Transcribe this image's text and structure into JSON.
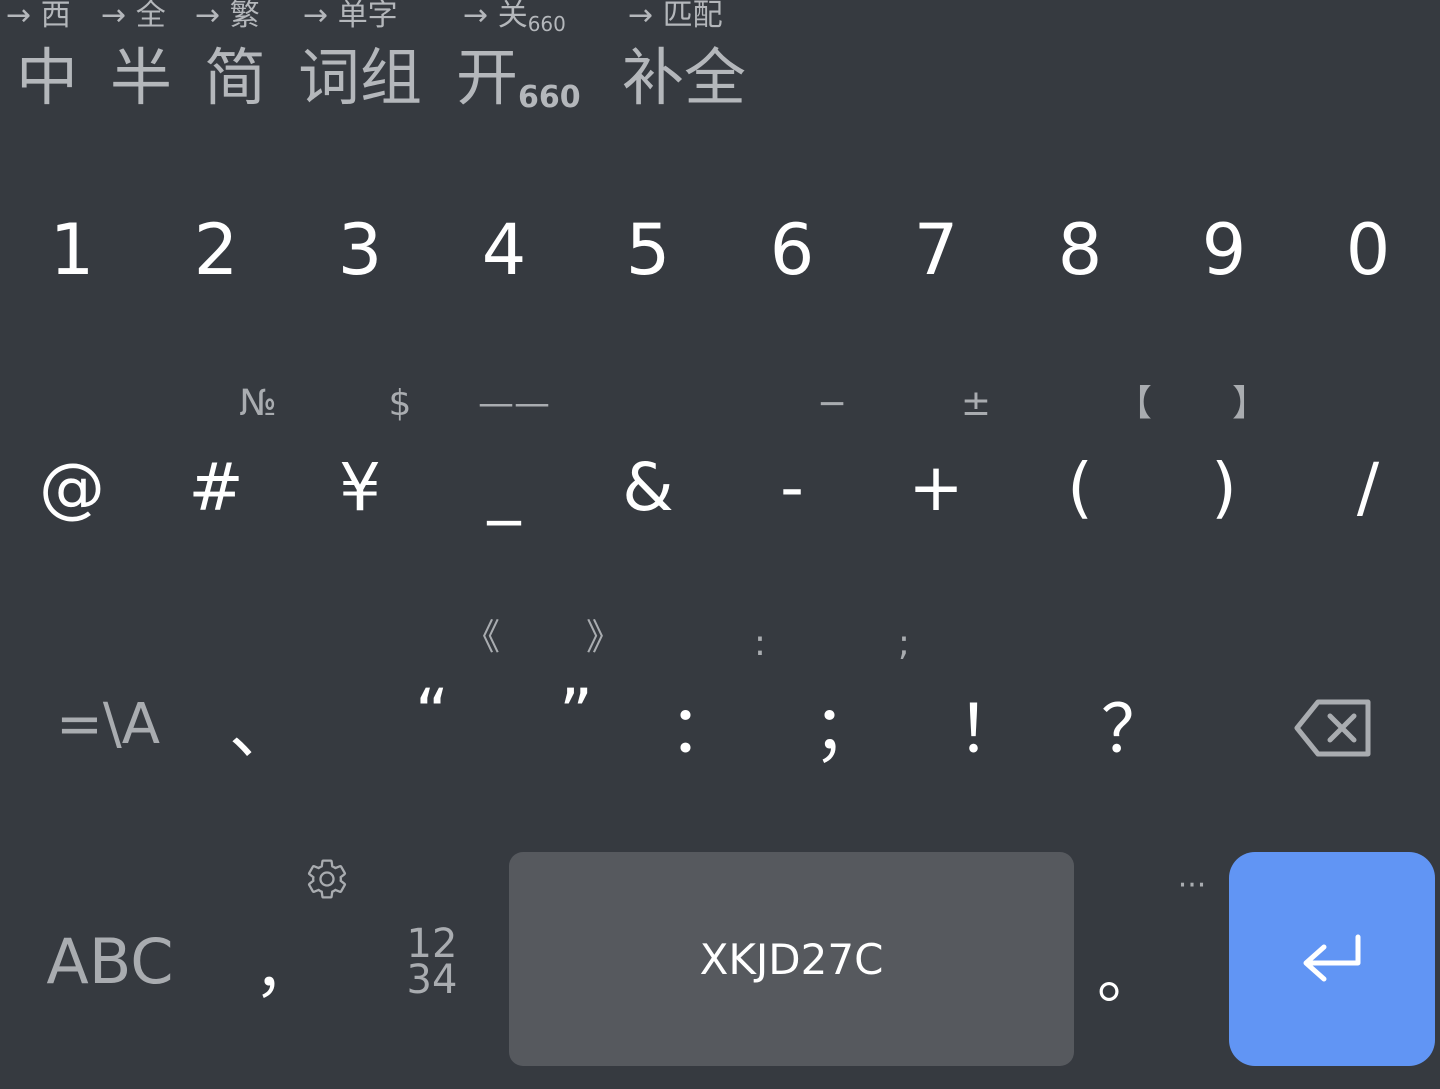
{
  "toolbar": {
    "hints": [
      {
        "prefix": "→",
        "text": "西"
      },
      {
        "prefix": "→",
        "text": "全"
      },
      {
        "prefix": "→",
        "text": "繁"
      },
      {
        "prefix": "→",
        "text": "单字"
      },
      {
        "prefix": "→",
        "text": "关",
        "sub": "660"
      },
      {
        "prefix": "→",
        "text": "匹配"
      }
    ],
    "buttons": [
      {
        "text": "中"
      },
      {
        "text": "半"
      },
      {
        "text": "简"
      },
      {
        "text": "词组"
      },
      {
        "text": "开",
        "sub": "660"
      },
      {
        "text": "补全"
      }
    ]
  },
  "number_row": [
    "1",
    "2",
    "3",
    "4",
    "5",
    "6",
    "7",
    "8",
    "9",
    "0"
  ],
  "symbol_row": {
    "keys": [
      "@",
      "#",
      "¥",
      "_",
      "&",
      "-",
      "+",
      "(",
      ")",
      "/"
    ],
    "hints": [
      "",
      "№",
      "$",
      "——",
      "",
      "−",
      "±",
      "【",
      "】",
      ""
    ]
  },
  "punct_row": {
    "mode_key": "=\\A",
    "keys": [
      "、",
      "“",
      "”",
      "：",
      "；",
      "！",
      "？"
    ],
    "hints": [
      "",
      "《",
      "》",
      ":",
      ";",
      "",
      ""
    ]
  },
  "bottom_row": {
    "abc": "ABC",
    "comma": "，",
    "numpad_top": "12",
    "numpad_bottom": "34",
    "space_label": "XKJD27C",
    "period": "。",
    "more_hint": "···"
  },
  "icons": {
    "settings": "gear-icon",
    "backspace": "backspace-icon",
    "enter": "enter-icon"
  },
  "colors": {
    "background": "#363a40",
    "space_key": "#56595e",
    "enter_key": "#6195f4",
    "hint_text": "#a9acb0"
  }
}
